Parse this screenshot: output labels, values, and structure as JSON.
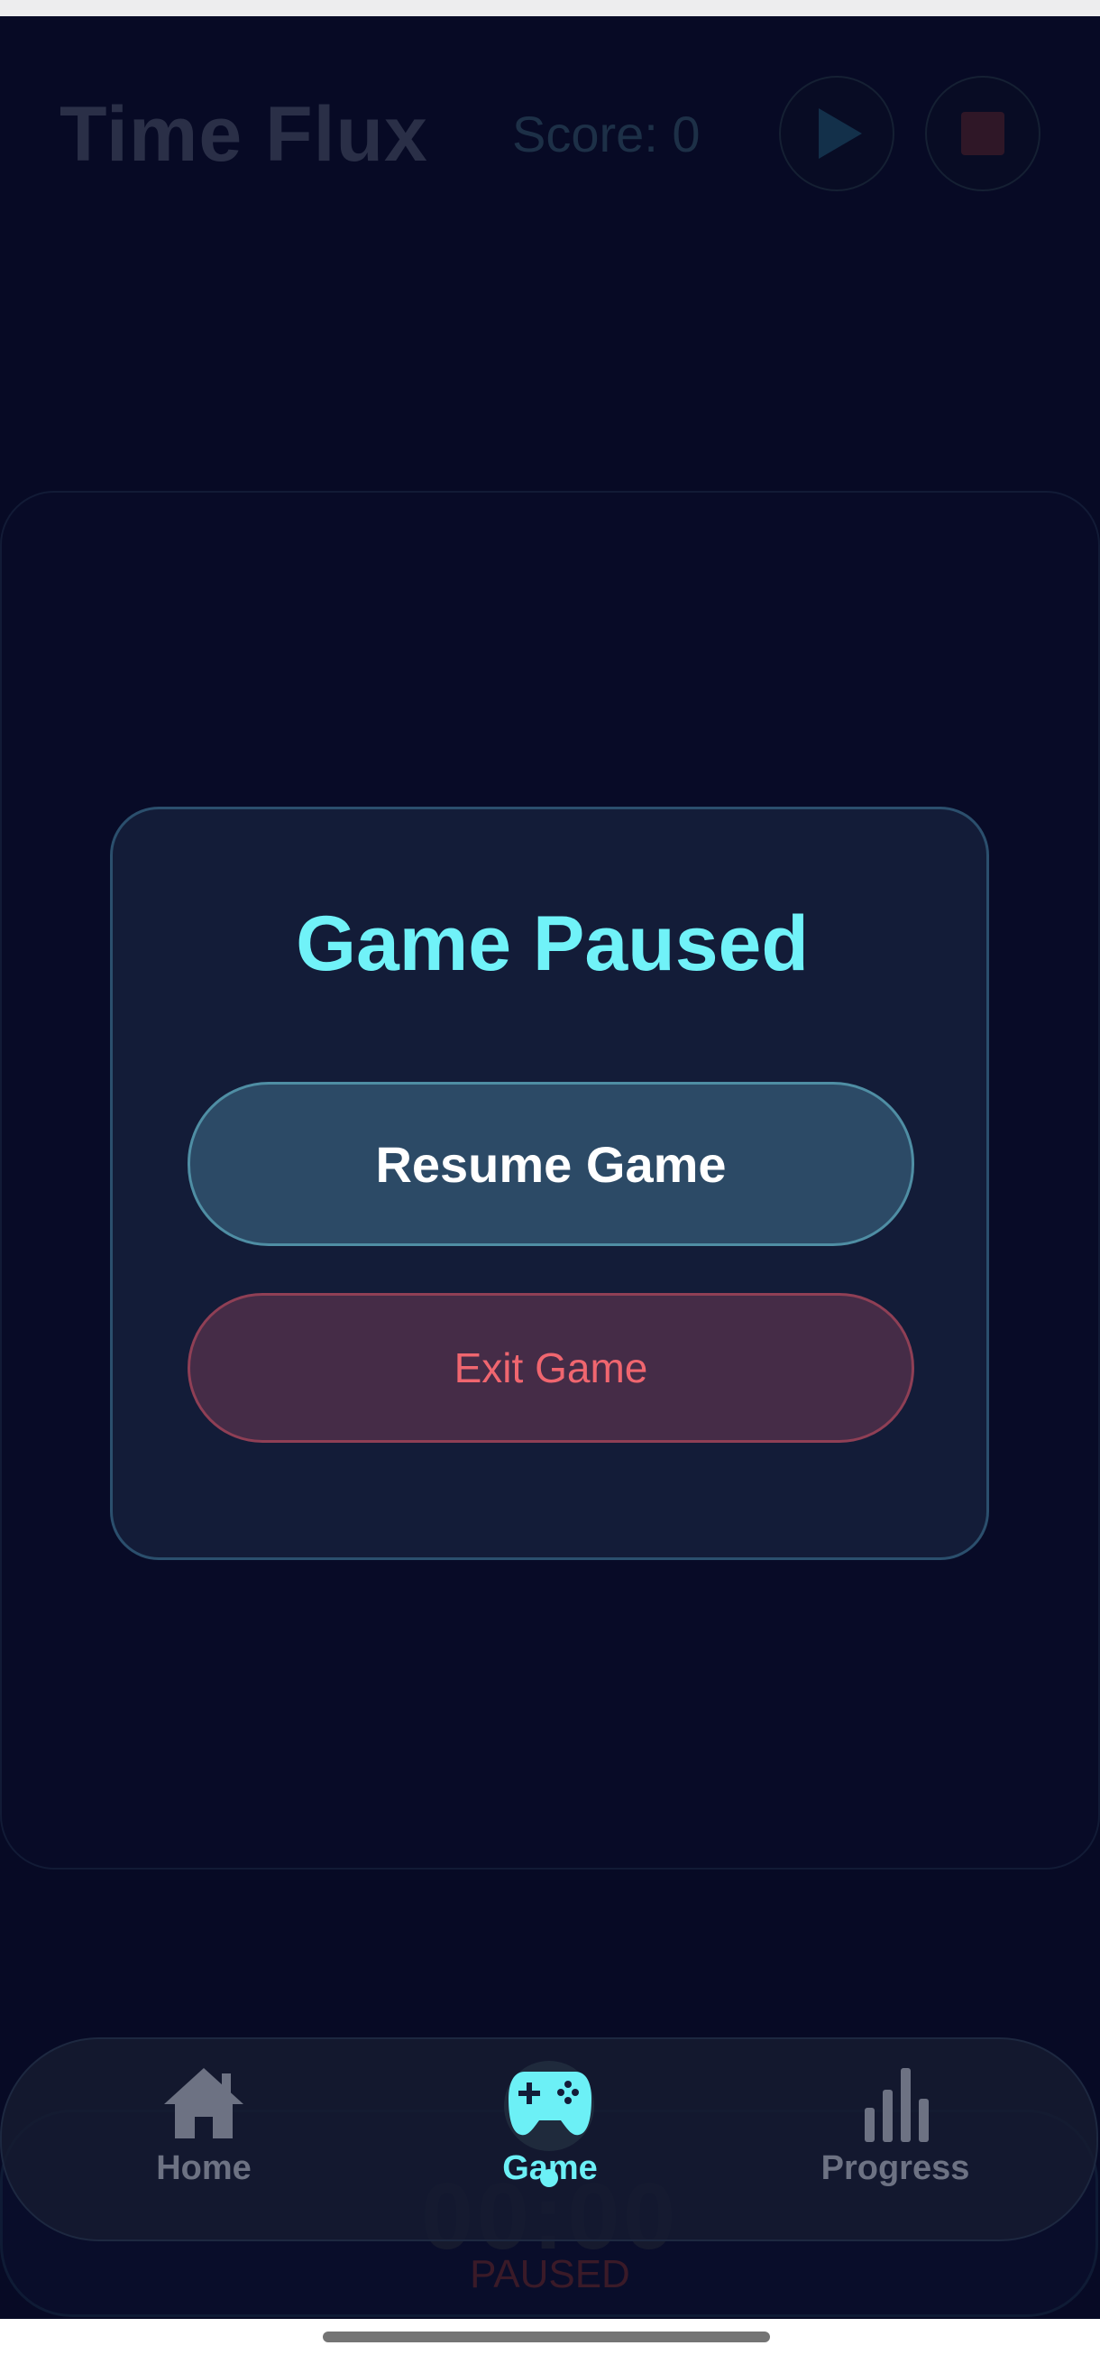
{
  "header": {
    "title": "Time Flux",
    "score_label": "Score: 0",
    "play_icon": "play-icon",
    "stop_icon": "stop-icon"
  },
  "timer": {
    "time": "00:00",
    "status": "PAUSED"
  },
  "pause_dialog": {
    "title": "Game Paused",
    "resume_label": "Resume Game",
    "exit_label": "Exit Game"
  },
  "nav": {
    "items": [
      {
        "label": "Home",
        "icon": "home-icon",
        "active": false
      },
      {
        "label": "Game",
        "icon": "gamepad-icon",
        "active": true
      },
      {
        "label": "Progress",
        "icon": "bar-chart-icon",
        "active": false
      }
    ]
  },
  "colors": {
    "background": "#070a25",
    "accent": "#70f2f8",
    "danger": "#f0666f",
    "dialog": "#131c38"
  }
}
